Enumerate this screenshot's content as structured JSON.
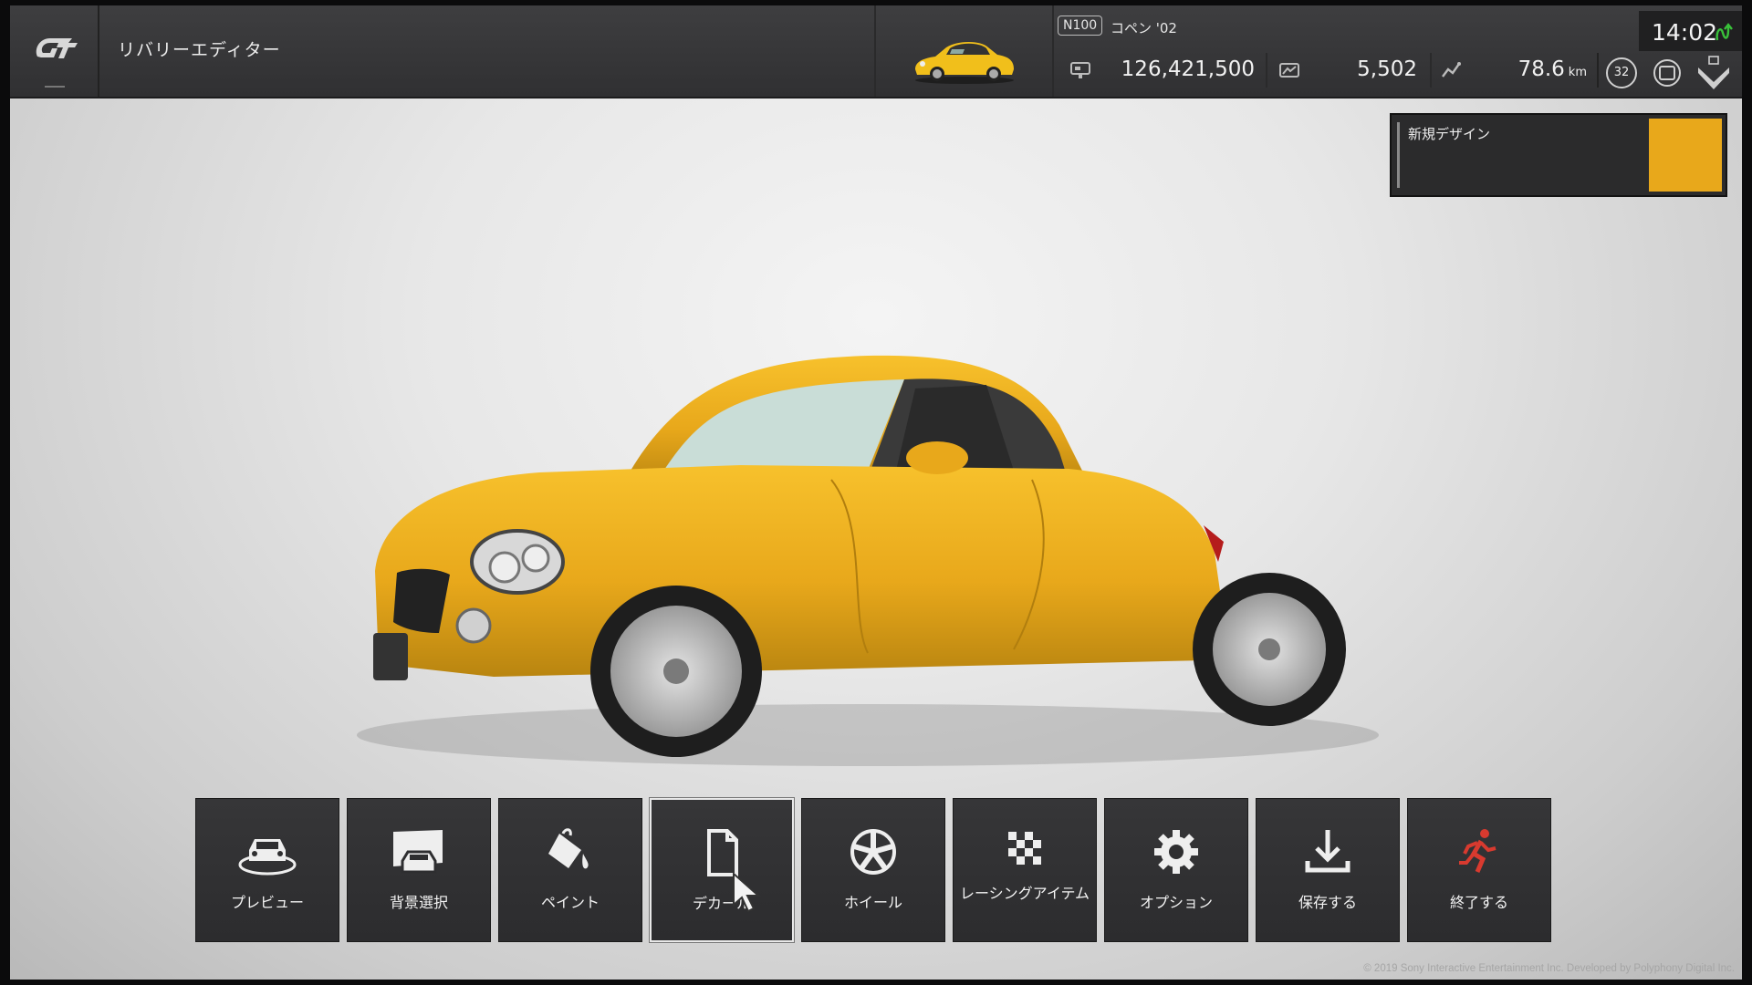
{
  "app": {
    "title": "リバリーエディター",
    "accent_color": "#e8a81b"
  },
  "header": {
    "car_badge": "N100",
    "car_name": "コペン '02",
    "credits": "126,421,500",
    "mileage_points": "5,502",
    "distance": "78.6",
    "distance_unit": "km",
    "level": "32",
    "clock": "14:02",
    "network_status_color": "#39c23a",
    "icons": [
      "gt-logo-icon",
      "credits-icon",
      "mileage-icon",
      "distance-icon",
      "map-icon",
      "emblem-icon",
      "network-icon"
    ]
  },
  "design_panel": {
    "title": "新規デザイン",
    "swatch_color": "#e8a81b"
  },
  "menu": {
    "items": [
      {
        "label": "プレビュー",
        "icon": "car-preview-icon"
      },
      {
        "label": "背景選択",
        "icon": "background-select-icon"
      },
      {
        "label": "ペイント",
        "icon": "paint-bucket-icon"
      },
      {
        "label": "デカール",
        "icon": "decal-document-icon",
        "selected": true
      },
      {
        "label": "ホイール",
        "icon": "wheel-icon"
      },
      {
        "label": "レーシングアイテム",
        "icon": "checkered-flag-icon"
      },
      {
        "label": "オプション",
        "icon": "gear-icon"
      },
      {
        "label": "保存する",
        "icon": "download-save-icon"
      },
      {
        "label": "終了する",
        "icon": "exit-runner-icon"
      }
    ]
  },
  "footer": {
    "copyright": "© 2019 Sony Interactive Entertainment Inc. Developed by Polyphony Digital Inc."
  }
}
